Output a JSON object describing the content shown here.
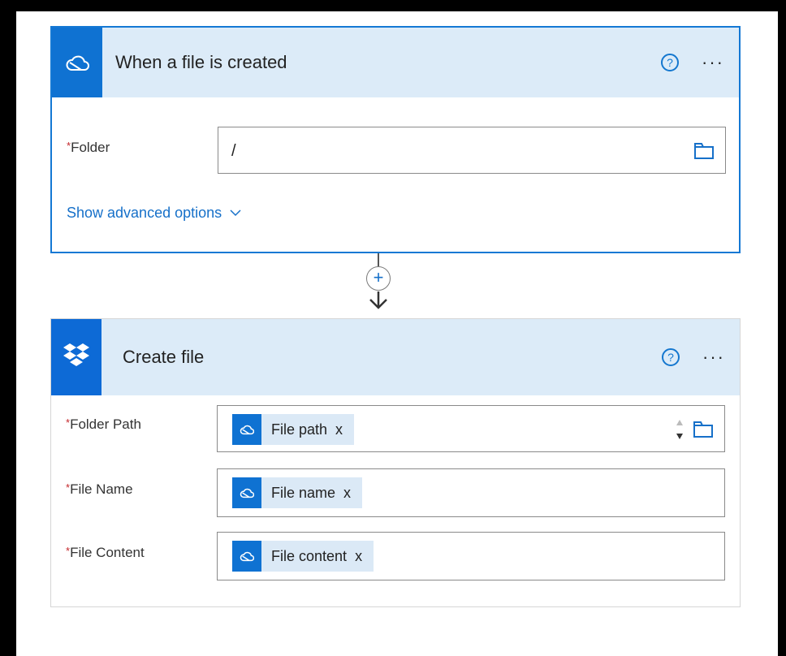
{
  "trigger": {
    "title": "When a file is created",
    "help_glyph": "?",
    "more_glyph": "···",
    "fields": {
      "folder": {
        "required_mark": "*",
        "label": "Folder",
        "value": "/"
      }
    },
    "advanced_label": "Show advanced options",
    "icon": "onedrive-cloud-icon"
  },
  "connector": {
    "plus_glyph": "+"
  },
  "action": {
    "title": "Create file",
    "help_glyph": "?",
    "more_glyph": "···",
    "icon": "dropbox-icon",
    "fields": {
      "folder_path": {
        "required_mark": "*",
        "label": "Folder Path",
        "token": "File path",
        "remove": "x"
      },
      "file_name": {
        "required_mark": "*",
        "label": "File Name",
        "token": "File name",
        "remove": "x"
      },
      "file_content": {
        "required_mark": "*",
        "label": "File Content",
        "token": "File content",
        "remove": "x"
      }
    }
  },
  "colors": {
    "accent": "#0f72d2",
    "header_bg": "#dcebf8",
    "required": "#c4272b",
    "link": "#1670c9"
  }
}
